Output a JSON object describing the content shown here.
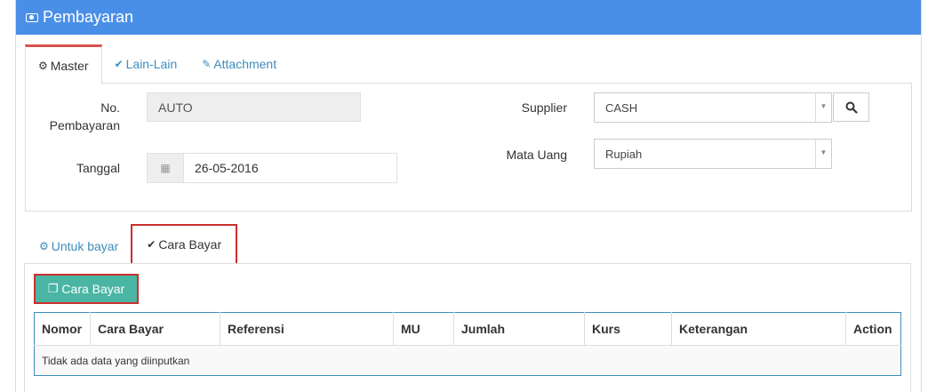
{
  "header": {
    "title": "Pembayaran",
    "icon": "money-icon"
  },
  "tabs_top": [
    {
      "label": "Master",
      "icon": "cogs-icon",
      "active": true
    },
    {
      "label": "Lain-Lain",
      "icon": "check-circle-icon",
      "active": false
    },
    {
      "label": "Attachment",
      "icon": "paperclip-icon",
      "active": false
    }
  ],
  "master": {
    "no_pembayaran_label_line1": "No.",
    "no_pembayaran_label_line2": "Pembayaran",
    "no_pembayaran_value": "AUTO",
    "tanggal_label": "Tanggal",
    "tanggal_value": "26-05-2016",
    "supplier_label": "Supplier",
    "supplier_value": "CASH",
    "mata_uang_label": "Mata Uang",
    "mata_uang_value": "Rupiah"
  },
  "tabs_bottom": [
    {
      "label": "Untuk bayar",
      "icon": "cogs-icon",
      "active": false
    },
    {
      "label": "Cara Bayar",
      "icon": "check-circle-icon",
      "active": true
    }
  ],
  "detail": {
    "add_button_label": "Cara Bayar",
    "columns": [
      "Nomor",
      "Cara Bayar",
      "Referensi",
      "MU",
      "Jumlah",
      "Kurs",
      "Keterangan",
      "Action"
    ],
    "empty_message": "Tidak ada data yang diinputkan"
  },
  "colors": {
    "header_bg": "#4a8fe7",
    "link": "#3c8dbc",
    "highlight_border": "#c9302c",
    "add_button_bg": "#4ab5a3"
  }
}
